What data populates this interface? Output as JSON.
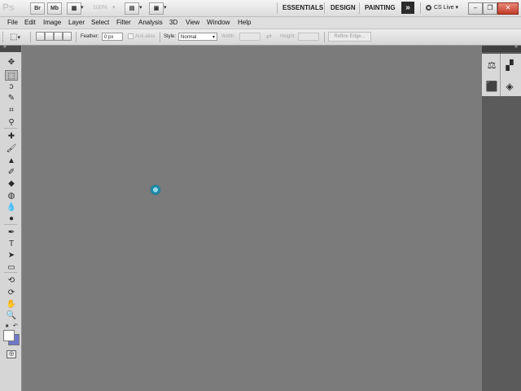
{
  "app": {
    "logo": "Ps",
    "bridge_label": "Br",
    "minibridge_label": "Mb",
    "zoom": "100%",
    "workspaces": [
      "ESSENTIALS",
      "DESIGN",
      "PAINTING"
    ],
    "more_workspaces": "»",
    "cs_live": "CS Live"
  },
  "menu": [
    "File",
    "Edit",
    "Image",
    "Layer",
    "Select",
    "Filter",
    "Analysis",
    "3D",
    "View",
    "Window",
    "Help"
  ],
  "options": {
    "feather_label": "Feather:",
    "feather_value": "0 px",
    "antialias_label": "Anti-alias",
    "style_label": "Style:",
    "style_value": "Normal",
    "width_label": "Width:",
    "height_label": "Height:",
    "swap_icon": "⇄",
    "refine_edge": "Refine Edge..."
  },
  "tools": [
    {
      "name": "move-tool-icon",
      "glyph": "✥"
    },
    {
      "name": "rectangular-marquee-tool-icon",
      "glyph": "⬚"
    },
    {
      "name": "lasso-tool-icon",
      "glyph": "ↄ"
    },
    {
      "name": "quick-selection-tool-icon",
      "glyph": "✎"
    },
    {
      "name": "crop-tool-icon",
      "glyph": "⌗"
    },
    {
      "name": "eyedropper-tool-icon",
      "glyph": "⚲"
    },
    {
      "name": "spot-healing-brush-icon",
      "glyph": "✚"
    },
    {
      "name": "brush-tool-icon",
      "glyph": "🖌"
    },
    {
      "name": "clone-stamp-tool-icon",
      "glyph": "▲"
    },
    {
      "name": "history-brush-icon",
      "glyph": "✐"
    },
    {
      "name": "eraser-tool-icon",
      "glyph": "◆"
    },
    {
      "name": "paint-bucket-tool-icon",
      "glyph": "◍"
    },
    {
      "name": "blur-tool-icon",
      "glyph": "💧"
    },
    {
      "name": "dodge-tool-icon",
      "glyph": "●"
    },
    {
      "name": "pen-tool-icon",
      "glyph": "✒"
    },
    {
      "name": "type-tool-icon",
      "glyph": "T"
    },
    {
      "name": "path-selection-tool-icon",
      "glyph": "➤"
    },
    {
      "name": "rectangle-shape-tool-icon",
      "glyph": "▭"
    },
    {
      "name": "3d-rotate-tool-icon",
      "glyph": "⟲"
    },
    {
      "name": "3d-orbit-tool-icon",
      "glyph": "⟳"
    },
    {
      "name": "hand-tool-icon",
      "glyph": "✋"
    },
    {
      "name": "zoom-tool-icon",
      "glyph": "🔍"
    }
  ],
  "colors": {
    "foreground": "#ffffff",
    "background": "#6f79c8",
    "accent_busy": "#1b8aa8"
  }
}
